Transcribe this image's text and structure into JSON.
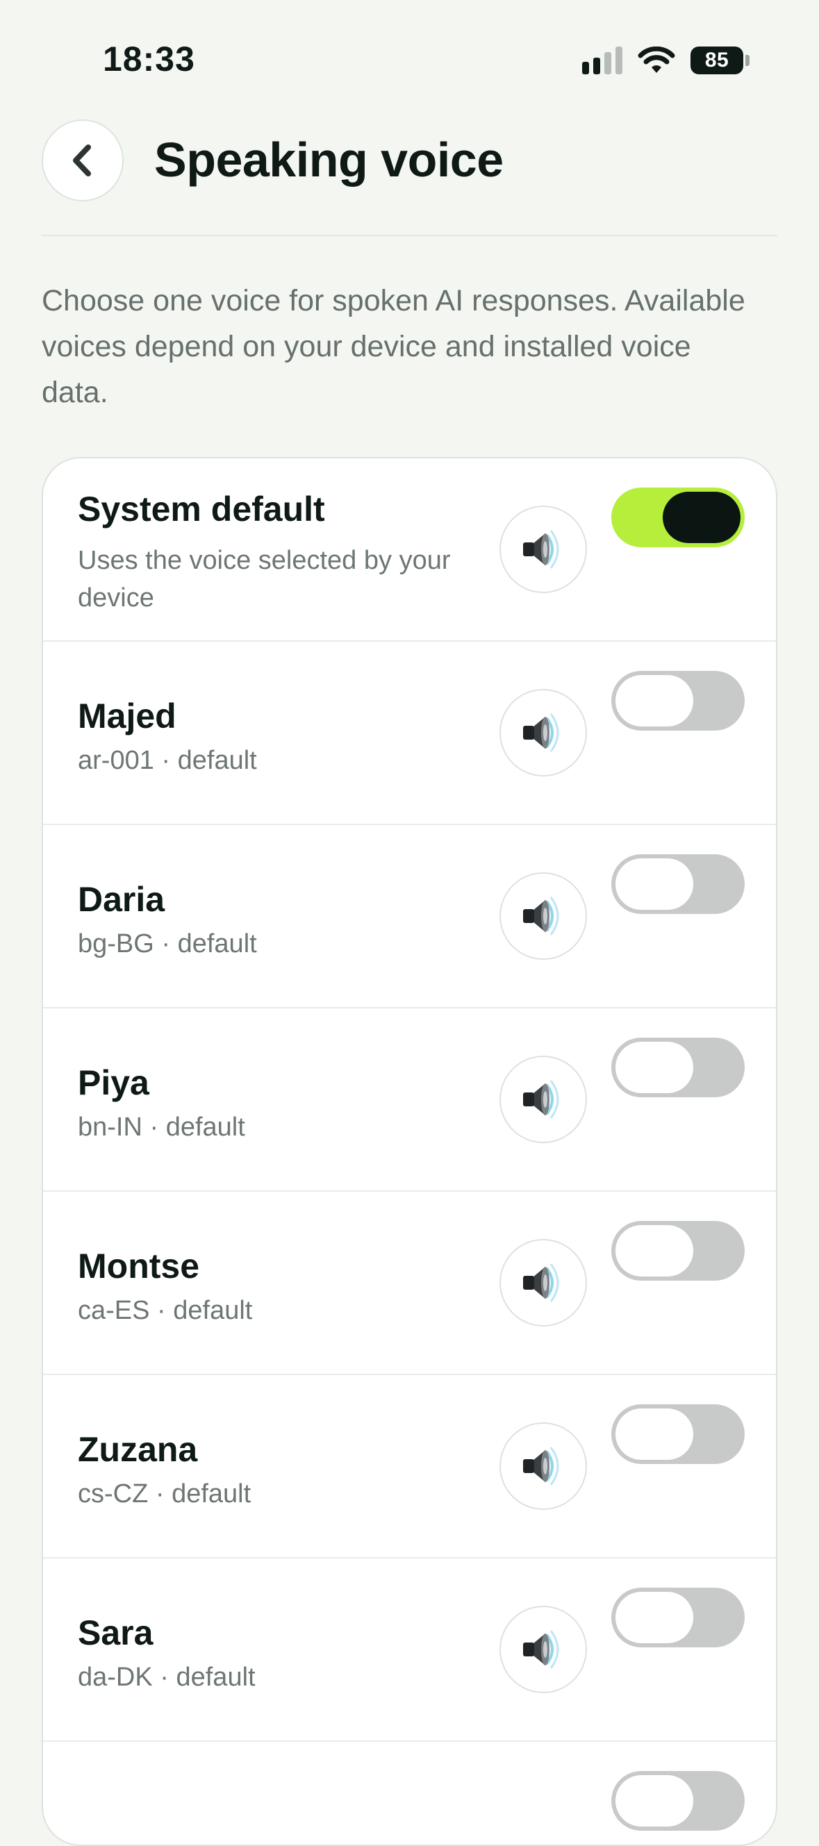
{
  "status_bar": {
    "time": "18:33",
    "battery": "85",
    "icons": [
      "cellular-signal-icon",
      "wifi-icon",
      "battery-icon"
    ]
  },
  "header": {
    "title": "Speaking voice",
    "back_icon": "chevron-left-icon"
  },
  "description": "Choose one voice for spoken AI responses. Available voices depend on your device and installed voice data.",
  "colors": {
    "accent": "#b5ef3c",
    "toggle_off": "#c8cac9",
    "background": "#f4f6f2",
    "knob_on": "#0b1512"
  },
  "voices": [
    {
      "name": "System default",
      "detail": "Uses the voice selected by your device",
      "selected": true
    },
    {
      "name": "Majed",
      "detail": "ar-001 · default",
      "selected": false
    },
    {
      "name": "Daria",
      "detail": "bg-BG · default",
      "selected": false
    },
    {
      "name": "Piya",
      "detail": "bn-IN · default",
      "selected": false
    },
    {
      "name": "Montse",
      "detail": "ca-ES · default",
      "selected": false
    },
    {
      "name": "Zuzana",
      "detail": "cs-CZ · default",
      "selected": false
    },
    {
      "name": "Sara",
      "detail": "da-DK · default",
      "selected": false
    }
  ],
  "preview_icon": "speaker-icon"
}
